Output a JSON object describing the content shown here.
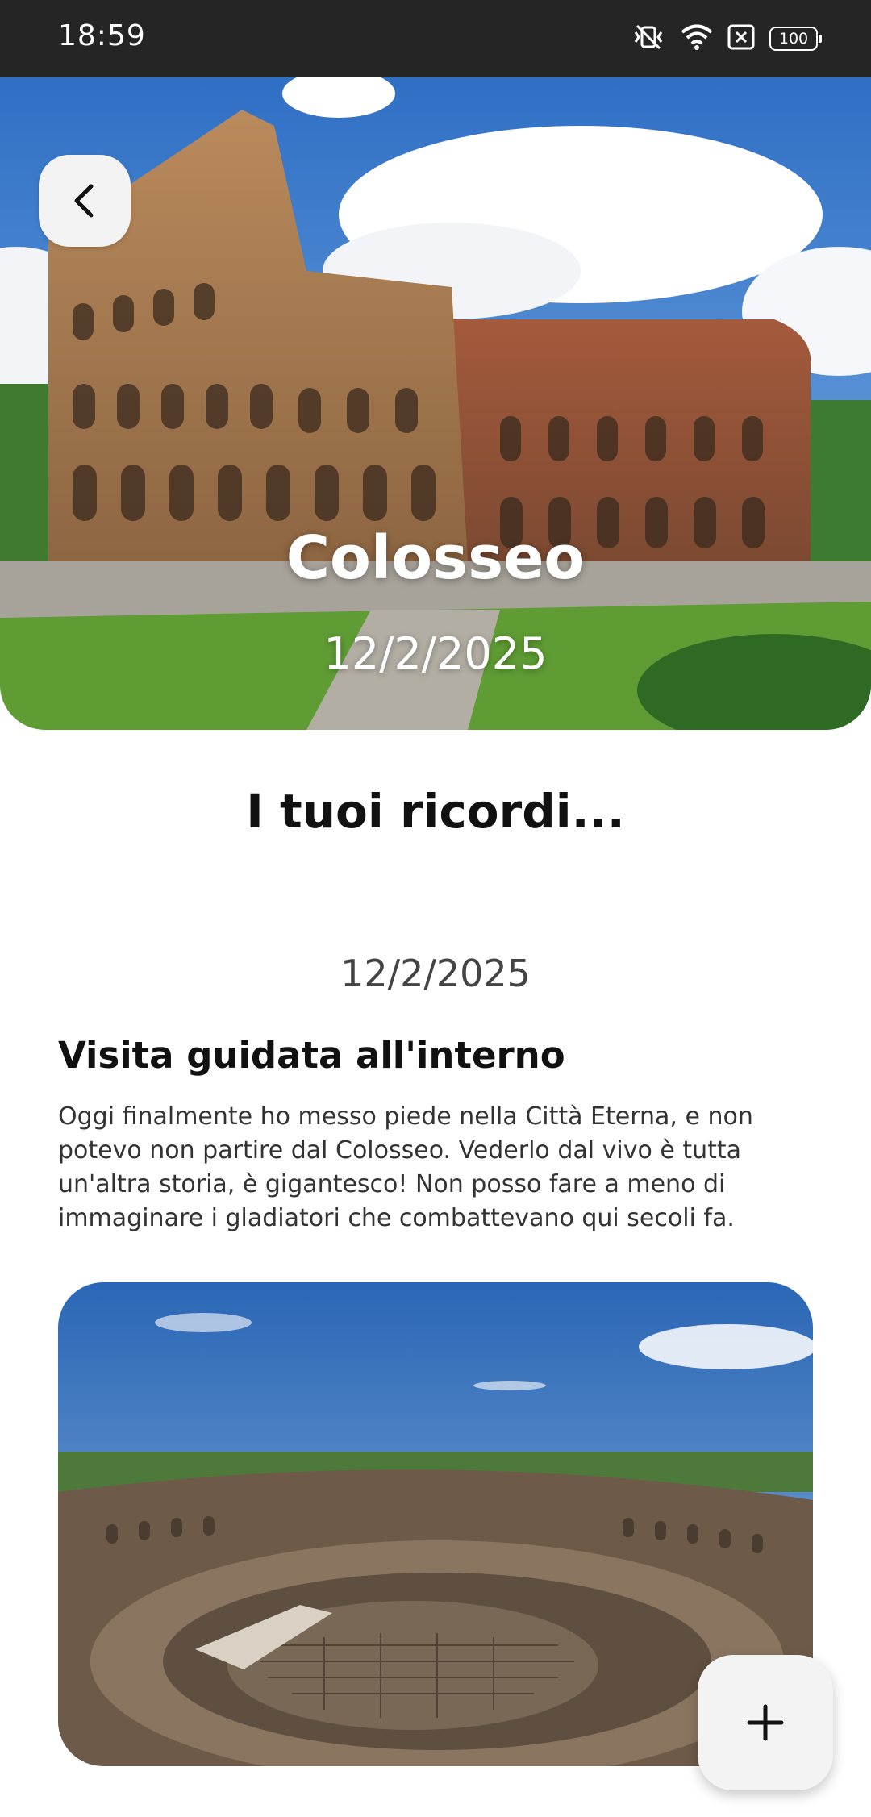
{
  "status_bar": {
    "time": "18:59",
    "battery": "100",
    "icons": [
      "vibrate-off-icon",
      "wifi-icon",
      "sim-x-icon",
      "battery-icon"
    ]
  },
  "place": {
    "name": "Colosseo",
    "date": "12/2/2025"
  },
  "section_title": "I tuoi ricordi...",
  "memories": [
    {
      "date": "12/2/2025",
      "title": "Visita guidata all'interno",
      "text": "Oggi finalmente ho messo piede nella Città Eterna, e non potevo non partire dal Colosseo. Vederlo dal vivo è tutta un'altra storia, è gigantesco! Non posso fare a meno di immaginare i gladiatori che combattevano qui secoli fa."
    }
  ],
  "icons": {
    "back": "chevron-left-icon",
    "fab": "plus-icon"
  },
  "colors": {
    "status_bar_bg": "#252525",
    "button_bg": "#f3f3f3",
    "text": "#111111"
  }
}
